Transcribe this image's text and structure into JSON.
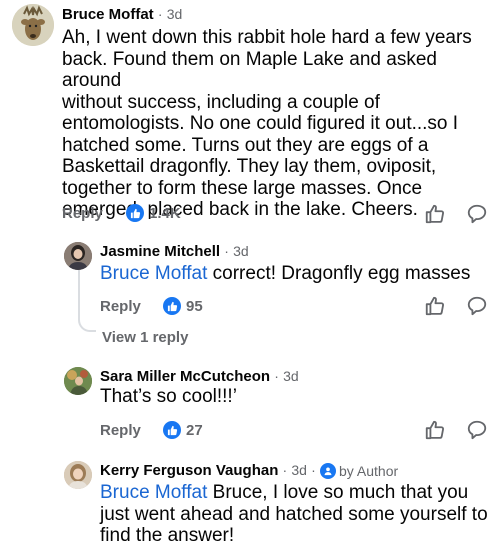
{
  "comments": [
    {
      "author": "Bruce Moffat",
      "time": "3d",
      "text": "Ah, I went down this rabbit hole hard a few years back. Found them on Maple Lake and asked around without success, including a couple of entomologists. No one could figured it out...so I hatched some. Turns out they are eggs of a Baskettail dragonfly. They lay them, oviposit, together to form these large masses. Once emerged, placed back in the lake. Cheers.",
      "lines": [
        "Ah, I went down this rabbit hole hard a few years",
        "back. Found them on Maple Lake and asked around",
        "without success, including a couple of",
        "entomologists. No one could figured it out...so I",
        "hatched some. Turns out they are eggs of a",
        "Baskettail dragonfly. They lay them, oviposit,",
        "together to form these large masses. Once",
        "emerged, placed back in the lake. Cheers."
      ],
      "reply_label": "Reply",
      "reactions": "1.4K"
    },
    {
      "author": "Jasmine Mitchell",
      "time": "3d",
      "mention": "Bruce Moffat",
      "text": " correct! Dragonfly egg masses",
      "reply_label": "Reply",
      "reactions": "95",
      "view_replies": "View 1 reply"
    },
    {
      "author": "Sara Miller McCutcheon",
      "time": "3d",
      "text": "That’s so cool!!!’",
      "reply_label": "Reply",
      "reactions": "27"
    },
    {
      "author": "Kerry Ferguson Vaughan",
      "time": "3d",
      "badge": "by Author",
      "mention": "Bruce Moffat",
      "line1_rest": " Bruce, I love so much that you",
      "line2": "just went ahead and hatched some yourself to",
      "line3": "find the answer!"
    }
  ],
  "separator": "·",
  "icons": [
    "like-icon",
    "thumbs-up-outline-icon",
    "comment-icon",
    "author-badge-icon"
  ],
  "colors": {
    "accent": "#1877f2",
    "mention": "#1a66d2",
    "muted": "#65676b",
    "thread": "#dadde1"
  }
}
